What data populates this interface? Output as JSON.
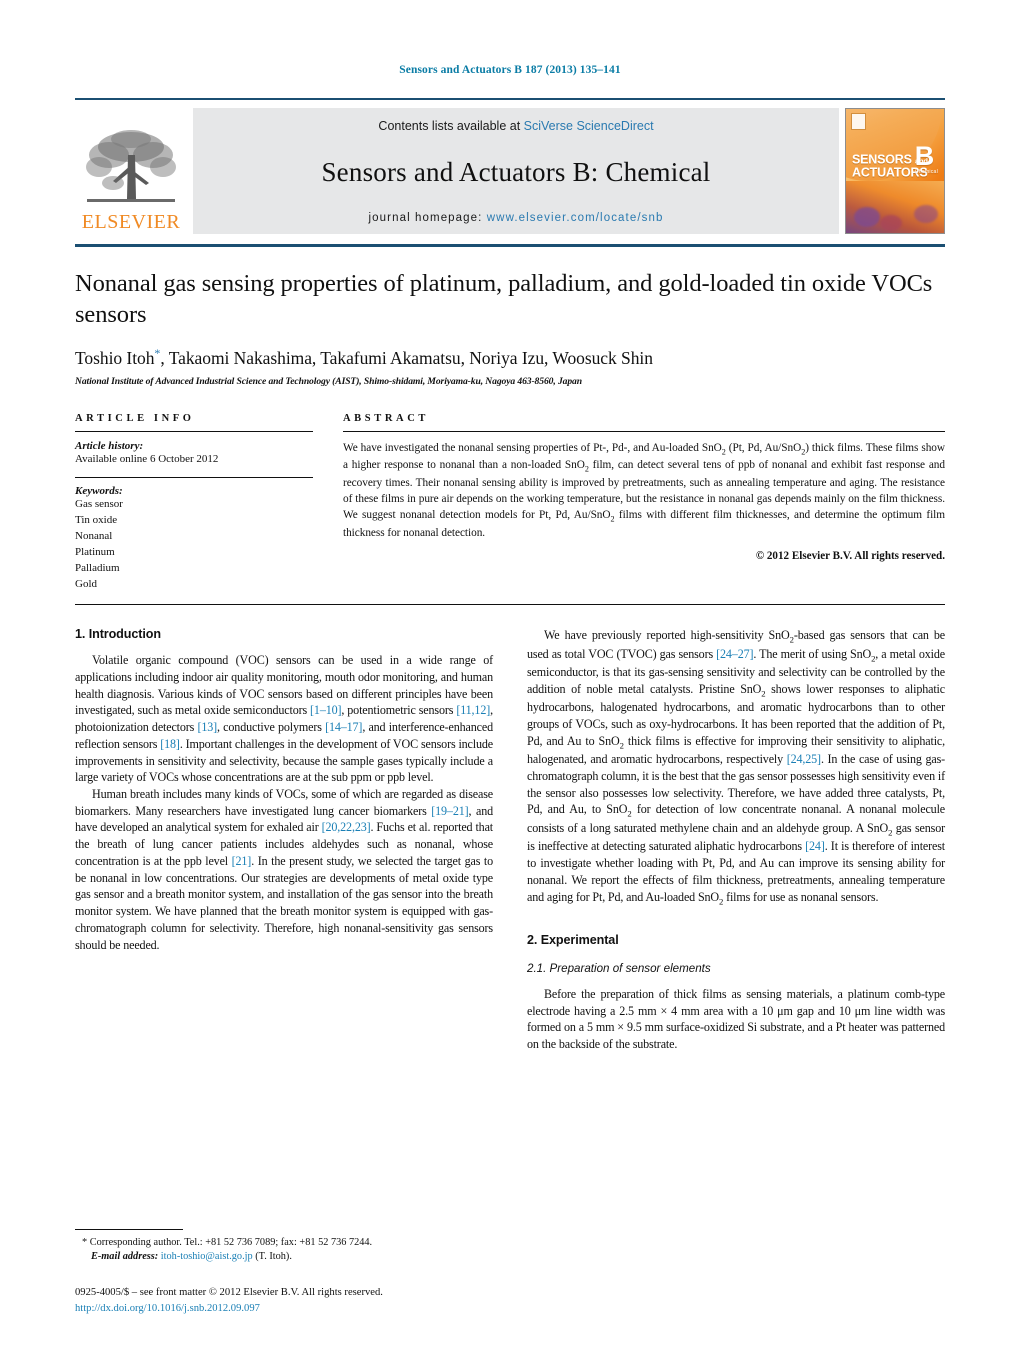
{
  "running_head": "Sensors and Actuators B 187 (2013) 135–141",
  "masthead": {
    "elsevier_wordmark": "ELSEVIER",
    "contents_prefix": "Contents lists available at ",
    "contents_link": "SciVerse ScienceDirect",
    "journal_title": "Sensors and Actuators B: Chemical",
    "homepage_prefix": "journal homepage: ",
    "homepage_link": "www.elsevier.com/locate/snb",
    "cover": {
      "line1": "SENSORS",
      "and": "and",
      "line2": "ACTUATORS",
      "letter": "B",
      "letter_sub": "Chemical"
    }
  },
  "title": "Nonanal gas sensing properties of platinum, palladium, and gold-loaded tin oxide VOCs sensors",
  "authors": "Toshio Itoh",
  "authors_rest": ", Takaomi Nakashima, Takafumi Akamatsu, Noriya Izu, Woosuck Shin",
  "affiliation": "National Institute of Advanced Industrial Science and Technology (AIST), Shimo-shidami, Moriyama-ku, Nagoya 463-8560, Japan",
  "article_info": {
    "label": "ARTICLE INFO",
    "history_head": "Article history:",
    "history_line": "Available online 6 October 2012",
    "keywords_head": "Keywords:",
    "keywords": [
      "Gas sensor",
      "Tin oxide",
      "Nonanal",
      "Platinum",
      "Palladium",
      "Gold"
    ]
  },
  "abstract": {
    "label": "ABSTRACT",
    "p1_a": "We have investigated the nonanal sensing properties of Pt-, Pd-, and Au-loaded SnO",
    "p1_b": " (Pt, Pd, Au/SnO",
    "p1_c": ") thick films. These films show a higher response to nonanal than a non-loaded SnO",
    "p1_d": " film, can detect several tens of ppb of nonanal and exhibit fast response and recovery times. Their nonanal sensing ability is improved by pretreatments, such as annealing temperature and aging. The resistance of these films in pure air depends on the working temperature, but the resistance in nonanal gas depends mainly on the film thickness. We suggest nonanal detection models for Pt, Pd, Au/SnO",
    "p1_e": " films with different film thicknesses, and determine the optimum film thickness for nonanal detection.",
    "copyright": "© 2012 Elsevier B.V. All rights reserved."
  },
  "sections": {
    "intro_heading": "1.  Introduction",
    "experimental_heading": "2.  Experimental",
    "prep_heading": "2.1.  Preparation of sensor elements"
  },
  "left_column": {
    "p1_a": "Volatile organic compound (VOC) sensors can be used in a wide range of applications including indoor air quality monitoring, mouth odor monitoring, and human health diagnosis. Various kinds of VOC sensors based on different principles have been investigated, such as metal oxide semiconductors ",
    "p1_r1": "[1–10]",
    "p1_b": ", potentiometric sensors ",
    "p1_r2": "[11,12]",
    "p1_c": ", photoionization detectors ",
    "p1_r3": "[13]",
    "p1_d": ", conductive polymers ",
    "p1_r4": "[14–17]",
    "p1_e": ", and interference-enhanced reflection sensors ",
    "p1_r5": "[18]",
    "p1_f": ". Important challenges in the development of VOC sensors include improvements in sensitivity and selectivity, because the sample gases typically include a large variety of VOCs whose concentrations are at the sub ppm or ppb level.",
    "p2_a": "Human breath includes many kinds of VOCs, some of which are regarded as disease biomarkers. Many researchers have investigated lung cancer biomarkers ",
    "p2_r1": "[19–21]",
    "p2_b": ", and have developed an analytical system for exhaled air ",
    "p2_r2": "[20,22,23]",
    "p2_c": ". Fuchs et al. reported that the breath of lung cancer patients includes aldehydes such as nonanal, whose concentration is at the ppb level ",
    "p2_r3": "[21]",
    "p2_d": ". In the present study, we selected the target gas to be nonanal in low concentrations. Our strategies are developments of metal oxide type gas sensor and a breath monitor system, and installation of the gas sensor into the breath monitor system. We have planned that the breath monitor system is equipped with gas-chromatograph column for selectivity. Therefore, high nonanal-sensitivity gas sensors should be needed."
  },
  "right_column": {
    "p1_a": "We have previously reported high-sensitivity SnO",
    "p1_b": "-based gas sensors that can be used as total VOC (TVOC) gas sensors ",
    "p1_r1": "[24–27]",
    "p1_c": ". The merit of using SnO",
    "p1_d": ", a metal oxide semiconductor, is that its gas-sensing sensitivity and selectivity can be controlled by the addition of noble metal catalysts. Pristine SnO",
    "p1_e": " shows lower responses to aliphatic hydrocarbons, halogenated hydrocarbons, and aromatic hydrocarbons than to other groups of VOCs, such as oxy-hydrocarbons. It has been reported that the addition of Pt, Pd, and Au to SnO",
    "p1_f": " thick films is effective for improving their sensitivity to aliphatic, halogenated, and aromatic hydrocarbons, respectively ",
    "p1_r2": "[24,25]",
    "p1_g": ". In the case of using gas-chromatograph column, it is the best that the gas sensor possesses high sensitivity even if the sensor also possesses low selectivity. Therefore, we have added three catalysts, Pt, Pd, and Au, to SnO",
    "p1_h": " for detection of low concentrate nonanal. A nonanal molecule consists of a long saturated methylene chain and an aldehyde group. A SnO",
    "p1_i": " gas sensor is ineffective at detecting saturated aliphatic hydrocarbons ",
    "p1_r3": "[24]",
    "p1_j": ". It is therefore of interest to investigate whether loading with Pt, Pd, and Au can improve its sensing ability for nonanal. We report the effects of film thickness, pretreatments, annealing temperature and aging for Pt, Pd, and Au-loaded SnO",
    "p1_k": " films for use as nonanal sensors.",
    "p2": "Before the preparation of thick films as sensing materials, a platinum comb-type electrode having a 2.5 mm × 4 mm area with a 10 μm gap and 10 μm line width was formed on a 5 mm × 9.5 mm surface-oxidized Si substrate, and a Pt heater was patterned on the backside of the substrate."
  },
  "footnote": {
    "corresponding": "* Corresponding author. Tel.: +81 52 736 7089; fax: +81 52 736 7244.",
    "email_label": "E-mail address:",
    "email": "itoh-toshio@aist.go.jp",
    "email_suffix": "(T. Itoh).",
    "front_matter": "0925-4005/$ – see front matter © 2012 Elsevier B.V. All rights reserved.",
    "doi": "http://dx.doi.org/10.1016/j.snb.2012.09.097"
  },
  "colors": {
    "accent_blue": "#1a7fb5",
    "rule_navy": "#1b4f72",
    "elsevier_orange": "#f08a24",
    "band_gray": "#e6e7e8"
  }
}
